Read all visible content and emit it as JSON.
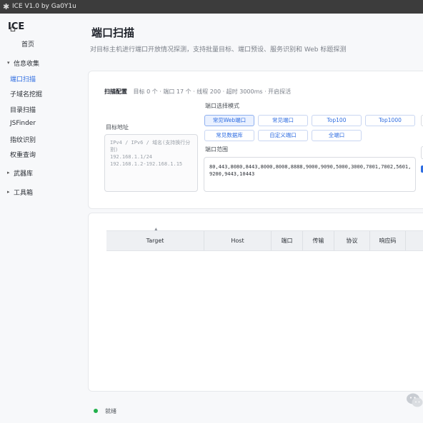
{
  "window": {
    "title": "ICE V1.0 by Ga0Y1u"
  },
  "sidebar": {
    "brand": "ICE",
    "home": "首页",
    "groups": [
      {
        "label": "信息收集",
        "expanded": true,
        "items": [
          "端口扫描",
          "子域名挖掘",
          "目录扫描",
          "JSFinder",
          "指纹识别",
          "权重查询"
        ]
      },
      {
        "label": "武器库",
        "expanded": false
      },
      {
        "label": "工具箱",
        "expanded": false
      }
    ],
    "active_item": "端口扫描"
  },
  "page": {
    "title": "端口扫描",
    "subtitle": "对目标主机进行端口开放情况探测，支持批量目标、端口预设、服务识别和 Web 标题探测"
  },
  "config": {
    "heading": "扫描配置",
    "summary": "目标 0 个 · 端口 17 个 · 线程 200 · 超时 3000ms · 开启探活",
    "target_label": "目标地址",
    "target_placeholder": "IPv4 / IPv6 / 域名(支持换行分割)\n192.168.1.1/24\n192.168.1.2-192.168.1.15",
    "mode_label": "端口选择模式",
    "presets": [
      "常见Web端口",
      "常见端口",
      "Top100",
      "Top1000",
      "常见数据库",
      "自定义端口",
      "全端口"
    ],
    "selected_preset": "常见Web端口",
    "range_label": "端口范围",
    "range_value": "80,443,8080,8443,8000,8008,8888,9000,9090,5000,3000,7001,7002,5601,\n9200,9443,10443"
  },
  "table": {
    "columns": [
      "Target",
      "Host",
      "端口",
      "传输",
      "协议",
      "响应码"
    ]
  },
  "status": {
    "text": "就绪",
    "color": "#21b04b"
  },
  "accent": "#2f6de1"
}
